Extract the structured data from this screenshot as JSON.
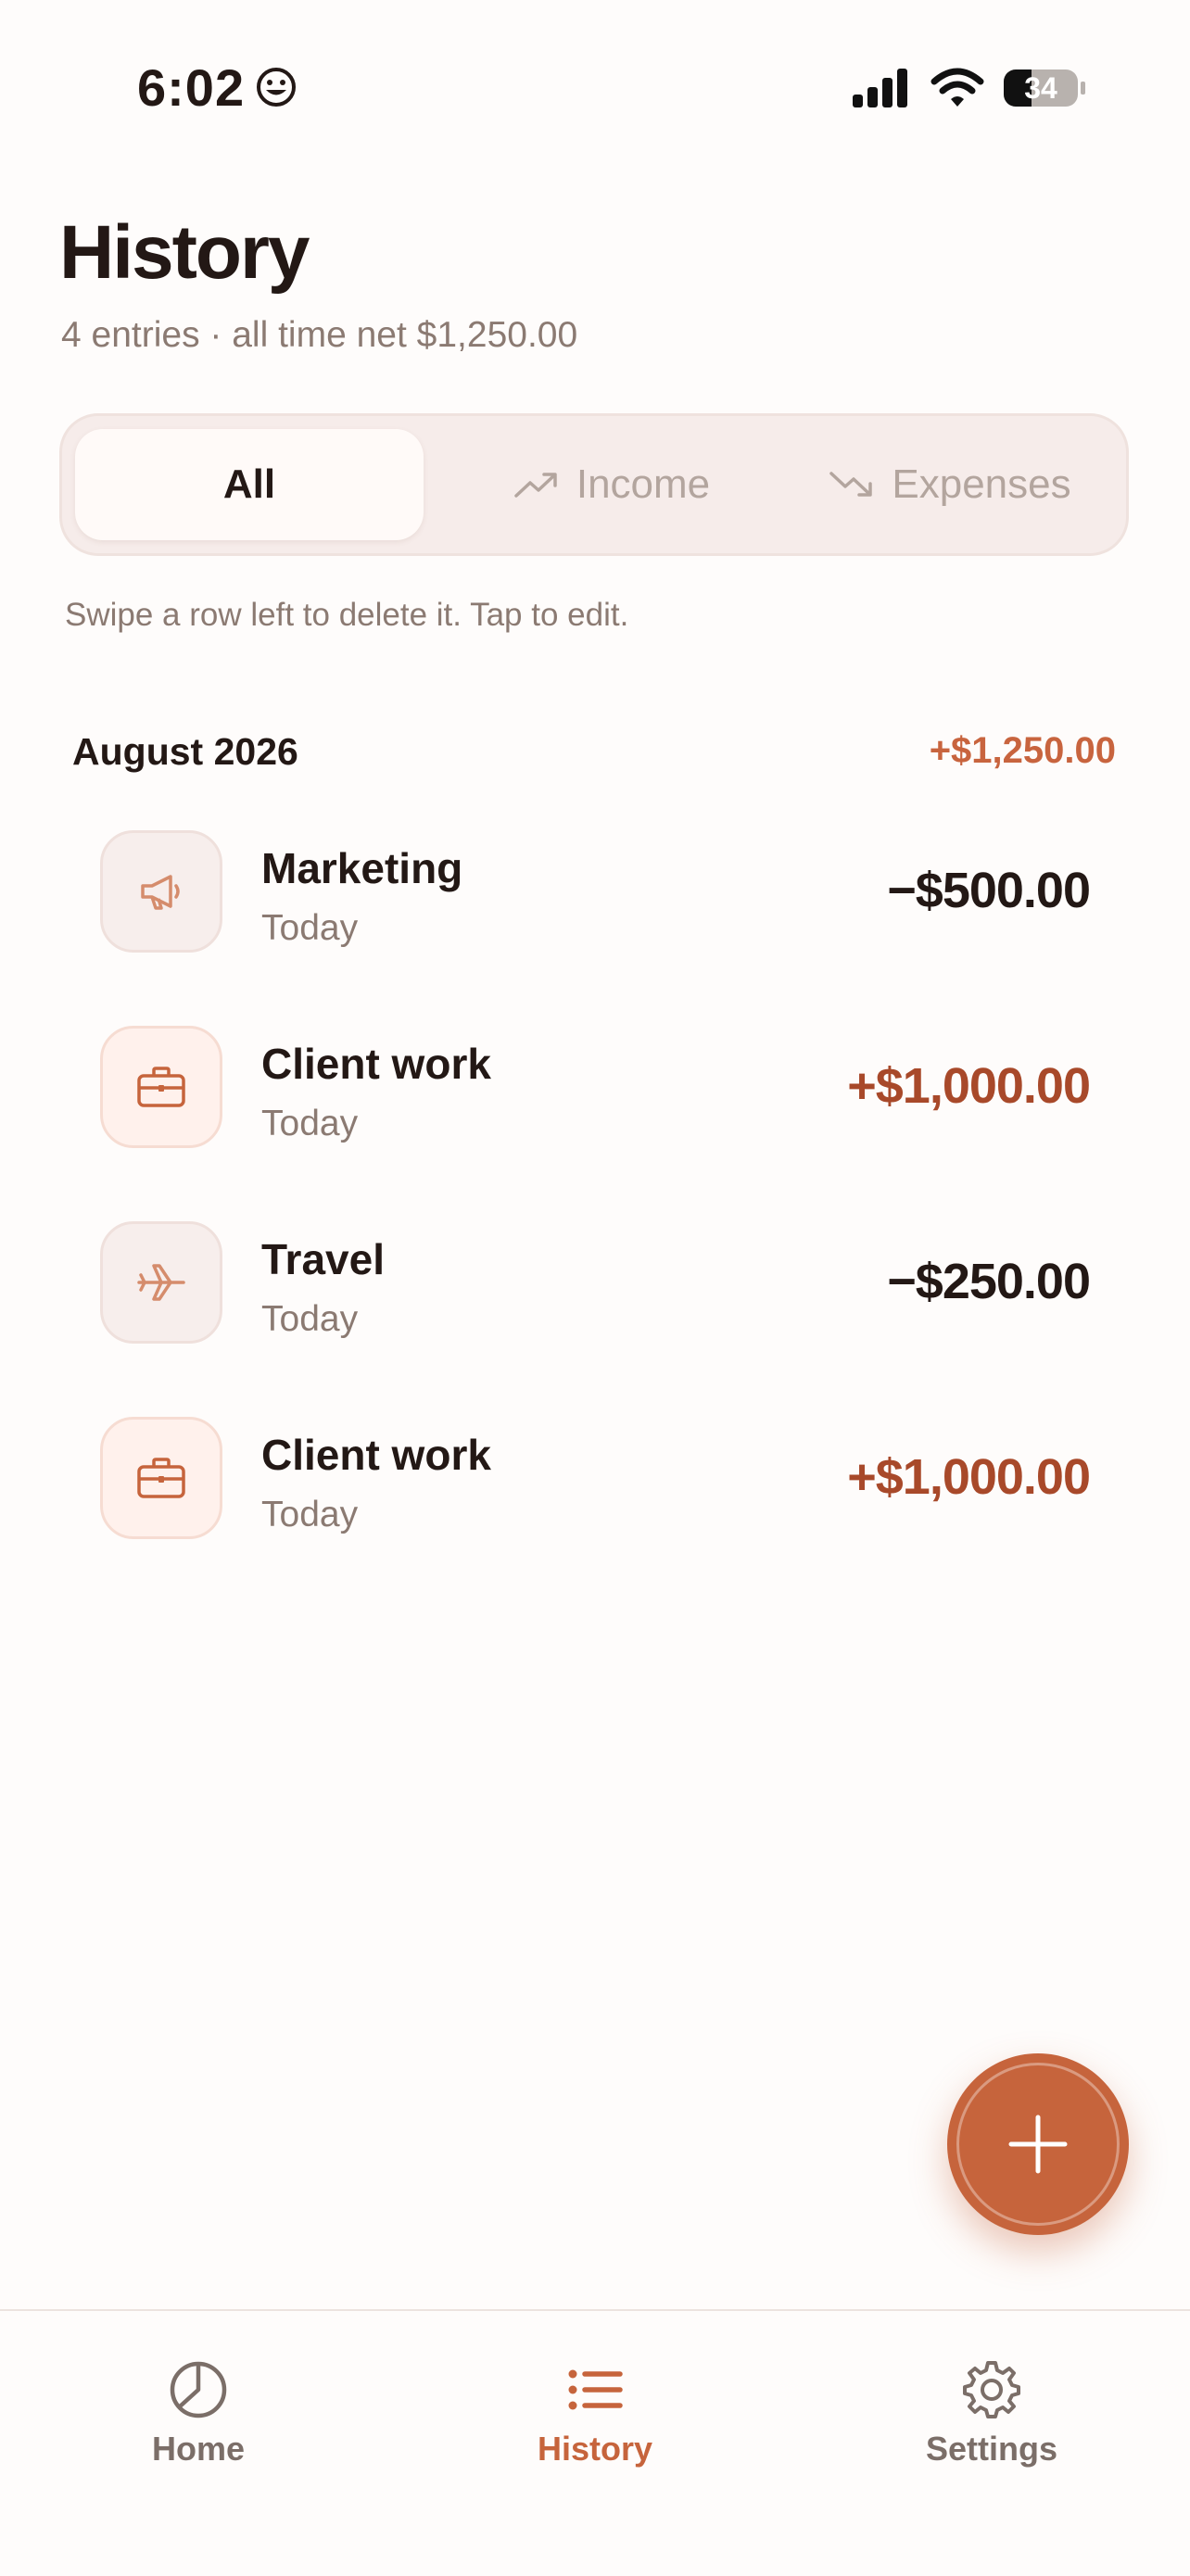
{
  "status_bar": {
    "time": "6:02",
    "battery": "34"
  },
  "header": {
    "title": "History",
    "subtitle": "4 entries · all time net $1,250.00"
  },
  "filter": {
    "options": [
      {
        "label": "All",
        "selected": true
      },
      {
        "label": "Income",
        "icon": "trending-up-icon"
      },
      {
        "label": "Expenses",
        "icon": "trending-down-icon"
      }
    ]
  },
  "hint": "Swipe a row left to delete it. Tap to edit.",
  "groups": [
    {
      "month": "August 2026",
      "total": "+$1,250.00",
      "entries": [
        {
          "name": "Marketing",
          "date": "Today",
          "amount": "−$500.00",
          "kind": "expense",
          "icon": "megaphone-icon"
        },
        {
          "name": "Client work",
          "date": "Today",
          "amount": "+$1,000.00",
          "kind": "income",
          "icon": "briefcase-icon"
        },
        {
          "name": "Travel",
          "date": "Today",
          "amount": "−$250.00",
          "kind": "expense",
          "icon": "airplane-icon"
        },
        {
          "name": "Client work",
          "date": "Today",
          "amount": "+$1,000.00",
          "kind": "income",
          "icon": "briefcase-icon"
        }
      ]
    }
  ],
  "tabs": [
    {
      "label": "Home",
      "icon": "pie-chart-icon"
    },
    {
      "label": "History",
      "icon": "list-icon",
      "active": true
    },
    {
      "label": "Settings",
      "icon": "gear-icon"
    }
  ],
  "colors": {
    "accent": "#c6643c",
    "income": "#a8492a",
    "text": "#231815",
    "muted": "#8b7a72"
  }
}
